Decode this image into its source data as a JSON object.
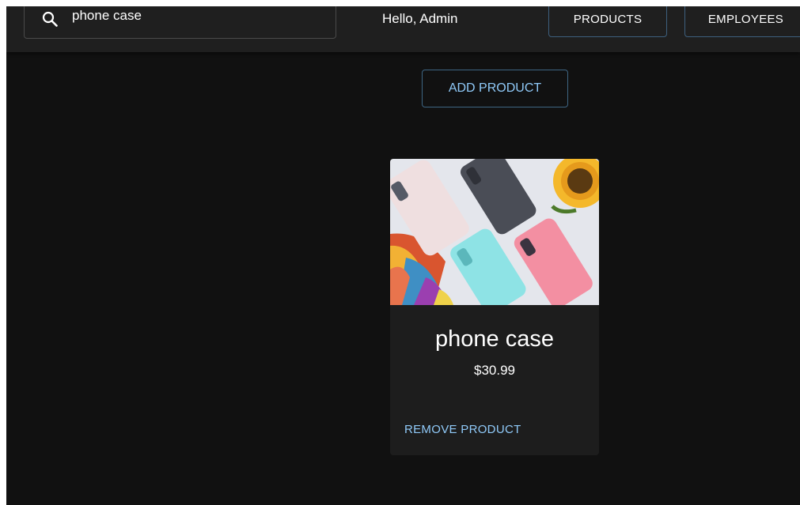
{
  "header": {
    "search": {
      "value": "phone case",
      "placeholder": "",
      "icon": "search-icon"
    },
    "greeting": "Hello, Admin",
    "nav": {
      "products_label": "PRODUCTS",
      "employees_label": "EMPLOYEES"
    }
  },
  "main": {
    "add_product_label": "ADD PRODUCT",
    "products": [
      {
        "name": "phone case",
        "price": "$30.99",
        "remove_label": "REMOVE PRODUCT"
      }
    ]
  },
  "colors": {
    "background": "#111111",
    "topbar": "#1f1f1f",
    "card": "#1d1d1d",
    "accent": "#90caf9"
  }
}
